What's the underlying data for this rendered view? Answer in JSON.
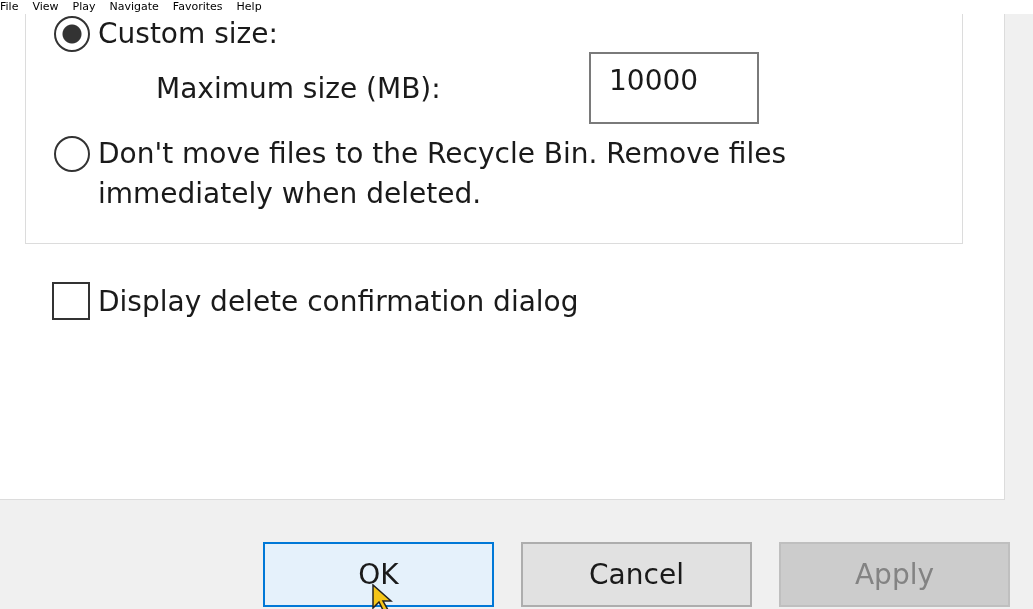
{
  "menu": [
    {
      "label": "File"
    },
    {
      "label": "View"
    },
    {
      "label": "Play"
    },
    {
      "label": "Navigate"
    },
    {
      "label": "Favorites"
    },
    {
      "label": "Help"
    }
  ],
  "recycle_options": [
    {
      "label": "Custom size:",
      "selected": true
    },
    {
      "label": "Don't move files to the Recycle Bin. Remove files immediately when deleted.",
      "selected": false
    }
  ],
  "max_size": {
    "label": "Maximum size (MB):",
    "value": "10000"
  },
  "confirm_dialog": {
    "label": "Display delete confirmation dialog",
    "checked": false
  },
  "buttons": [
    {
      "label": "OK",
      "default": true,
      "disabled": false
    },
    {
      "label": "Cancel",
      "default": false,
      "disabled": false
    },
    {
      "label": "Apply",
      "default": false,
      "disabled": true
    }
  ]
}
